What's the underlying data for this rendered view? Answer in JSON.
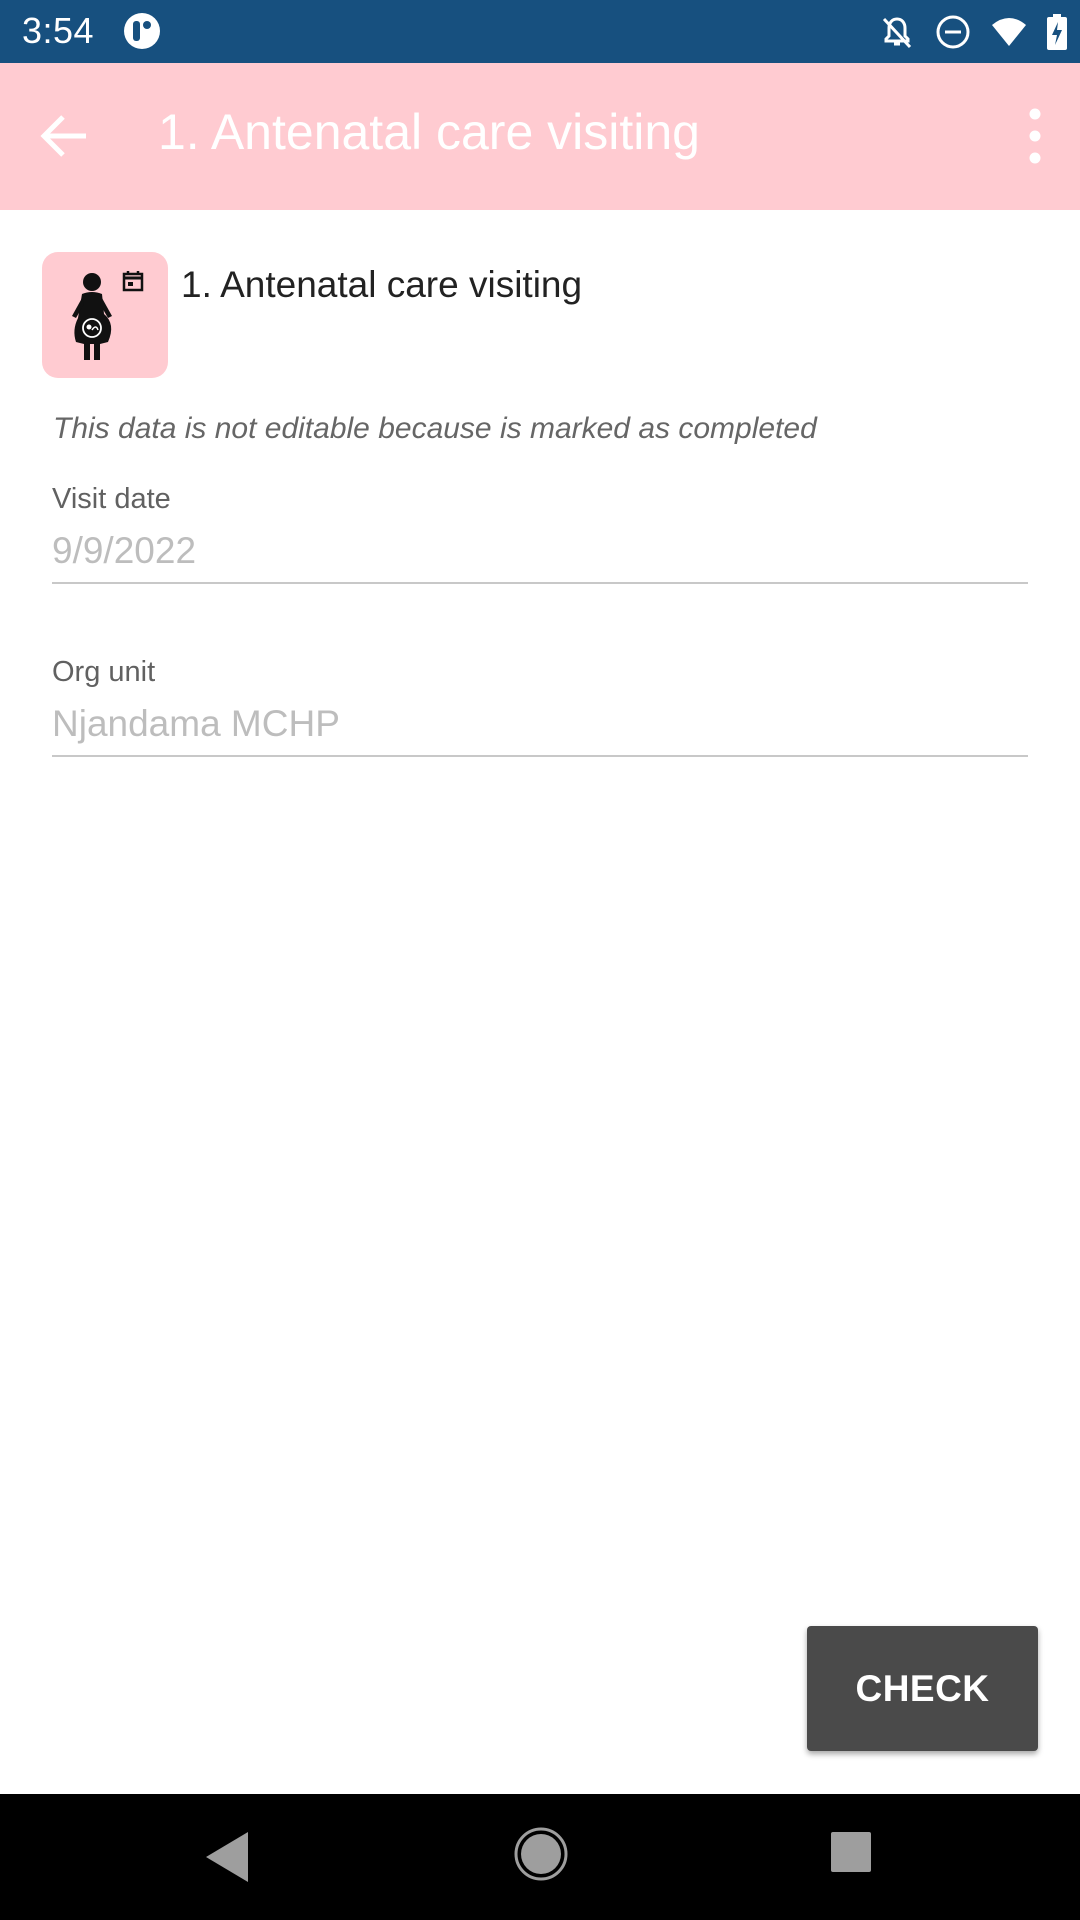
{
  "status_bar": {
    "time": "3:54",
    "icons": [
      "app-notification-icon",
      "notifications-off-icon",
      "do-not-disturb-icon",
      "wifi-icon",
      "battery-charging-icon"
    ]
  },
  "app_bar": {
    "title": "1. Antenatal care visiting",
    "back_icon": "arrow-back-icon",
    "menu_icon": "more-vert-icon",
    "color": "#ffcbd1"
  },
  "stage": {
    "title": "1. Antenatal care visiting",
    "icon": "pregnant-woman-calendar-icon"
  },
  "note": "This data is not editable because is marked as completed",
  "fields": [
    {
      "label": "Visit date",
      "value": "9/9/2022"
    },
    {
      "label": "Org unit",
      "value": "Njandama MCHP"
    }
  ],
  "actions": {
    "check_label": "CHECK"
  },
  "nav_bar": {
    "icons": [
      "back-triangle-icon",
      "home-circle-icon",
      "recents-square-icon"
    ]
  }
}
